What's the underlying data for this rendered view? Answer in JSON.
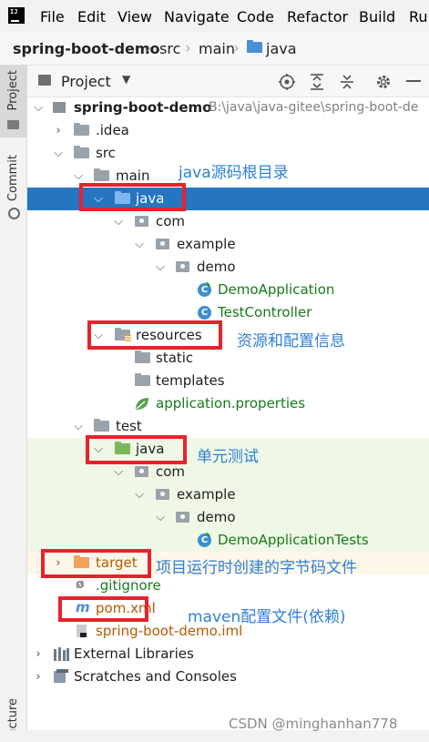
{
  "menubar": {
    "items": [
      "File",
      "Edit",
      "View",
      "Navigate",
      "Code",
      "Refactor",
      "Build",
      "Ru"
    ]
  },
  "breadcrumb": {
    "items": [
      "spring-boot-demo",
      "src",
      "main",
      "java"
    ]
  },
  "left_strip": {
    "tabs": [
      "Project",
      "Commit",
      "ructure"
    ]
  },
  "toolbar": {
    "view_label": "Project"
  },
  "tree": {
    "root": {
      "label": "spring-boot-demo",
      "path": "B:\\java\\java-gitee\\spring-boot-de"
    },
    "idea": ".idea",
    "src": "src",
    "main": "main",
    "main_java": "java",
    "com1": "com",
    "example1": "example",
    "demo1": "demo",
    "demo_application": "DemoApplication",
    "test_controller": "TestController",
    "resources": "resources",
    "static": "static",
    "templates": "templates",
    "application_properties": "application.properties",
    "test": "test",
    "test_java": "java",
    "com2": "com",
    "example2": "example",
    "demo2": "demo",
    "demo_application_tests": "DemoApplicationTests",
    "target": "target",
    "gitignore": ".gitignore",
    "pom": "pom.xml",
    "iml": "spring-boot-demo.iml",
    "external_libraries": "External Libraries",
    "scratches": "Scratches and Consoles"
  },
  "annotations": {
    "java_root": "java源码根目录",
    "resources": "资源和配置信息",
    "unit_test": "单元测试",
    "target": "项目运行时创建的字节码文件",
    "pom": "maven配置文件(依赖)"
  },
  "watermark": "CSDN @minghanhan778",
  "colors": {
    "selection": "#2675bf",
    "annotation": "#2f7fd6",
    "highlight_box": "#e8222d",
    "test_bg": "#eff8e6",
    "class_icon": "#3c8fd1"
  }
}
